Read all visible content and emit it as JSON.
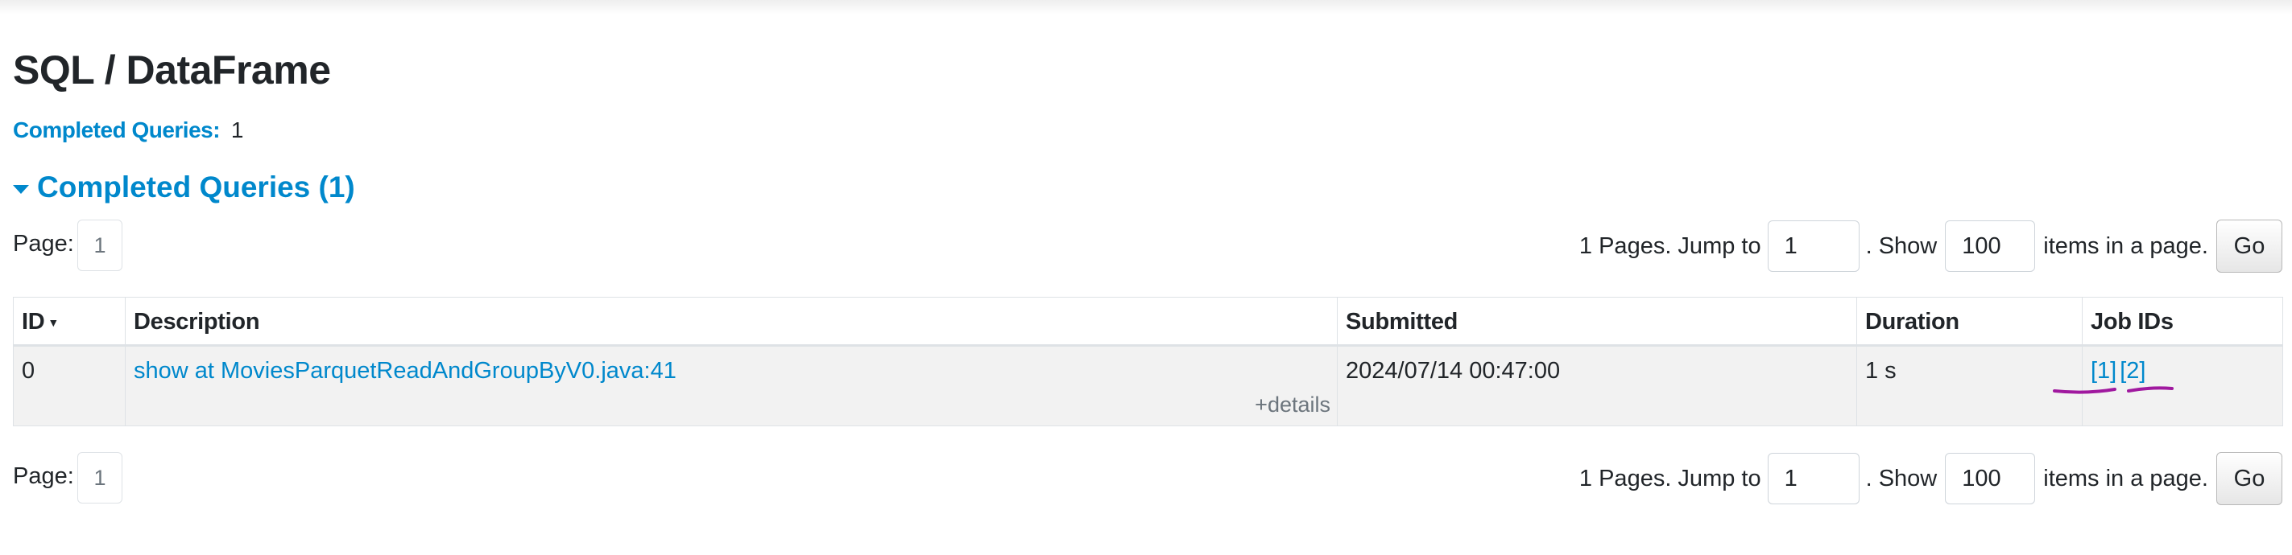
{
  "page": {
    "title": "SQL / DataFrame"
  },
  "summary": {
    "label": "Completed Queries:",
    "value": "1"
  },
  "section": {
    "label": "Completed Queries (1)"
  },
  "pagination": {
    "page_label": "Page:",
    "current_page": "1",
    "pages_text": "1 Pages. Jump to",
    "jump_value": "1",
    "show_text": ". Show",
    "show_value": "100",
    "items_text": "items in a page.",
    "go_label": "Go"
  },
  "table": {
    "headers": {
      "id": "ID",
      "description": "Description",
      "submitted": "Submitted",
      "duration": "Duration",
      "job_ids": "Job IDs"
    },
    "sort_indicator": "▼",
    "rows": [
      {
        "id": "0",
        "description": "show at MoviesParquetReadAndGroupByV0.java:41",
        "details": "+details",
        "submitted": "2024/07/14 00:47:00",
        "duration": "1 s",
        "job_ids": [
          "[1]",
          "[2]"
        ]
      }
    ]
  },
  "colors": {
    "link": "#0088cc",
    "annotation": "#a0199f"
  }
}
